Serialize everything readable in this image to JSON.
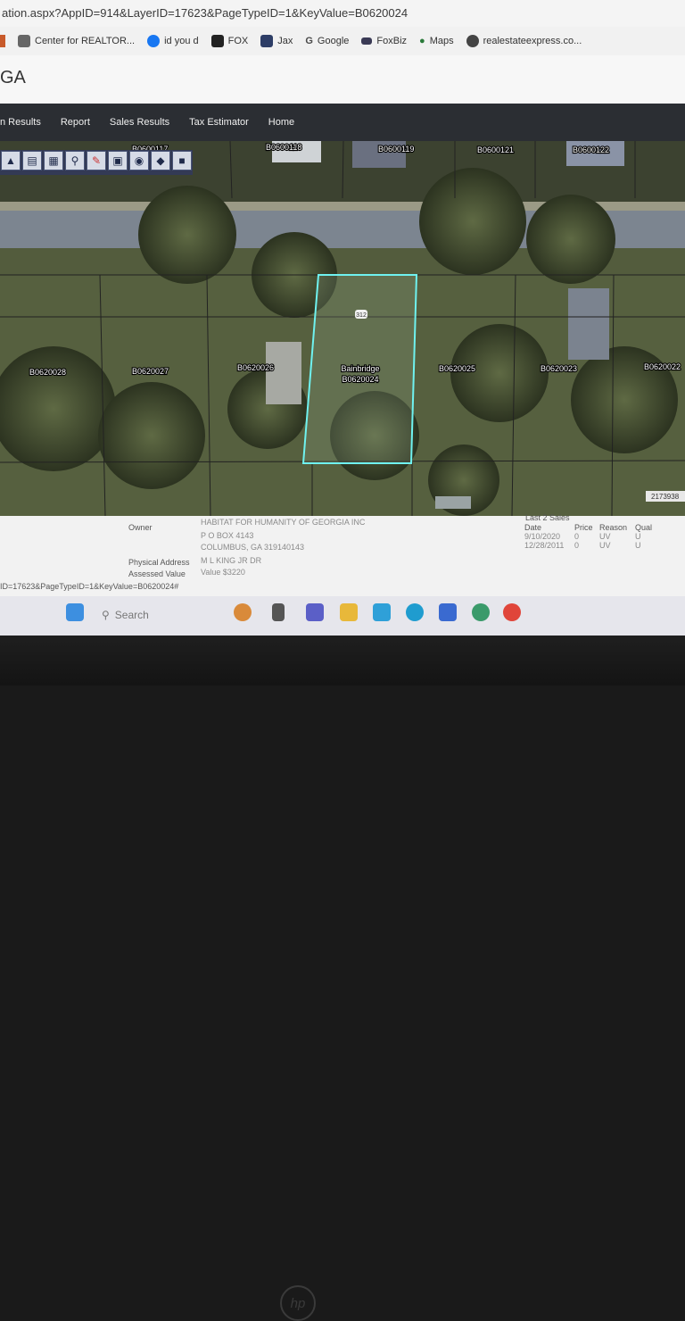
{
  "browser": {
    "url": "ation.aspx?AppID=914&LayerID=17623&PageTypeID=1&KeyValue=B0620024",
    "bookmarks": [
      {
        "label": "Center for REALTOR...",
        "icon": "bookmark-icon"
      },
      {
        "label": "id you d",
        "icon": "facebook-icon"
      },
      {
        "label": "FOX",
        "icon": "fox-icon"
      },
      {
        "label": "Jax",
        "icon": "page-icon"
      },
      {
        "label": "Google",
        "icon": "google-icon"
      },
      {
        "label": "FoxBiz",
        "icon": "foxbiz-icon"
      },
      {
        "label": "Maps",
        "icon": "maps-icon"
      },
      {
        "label": "realestateexpress.co...",
        "icon": "globe-icon"
      }
    ]
  },
  "app": {
    "title": "GA"
  },
  "nav": {
    "items": [
      "n Results",
      "Report",
      "Sales Results",
      "Tax Estimator",
      "Home"
    ]
  },
  "map": {
    "top_parcels": [
      "B0600117",
      "B0600118",
      "B0600119",
      "B0600121",
      "B0600122"
    ],
    "parcels": [
      "B0620028",
      "B0620027",
      "B0620026",
      "B0620025",
      "B0620023",
      "B0620022"
    ],
    "selected": {
      "name": "Bainbridge",
      "id": "B0620024",
      "number": "312"
    },
    "corner_id": "2173938"
  },
  "toolbar_icons": [
    "pan-icon",
    "layers-icon",
    "grid-icon",
    "zoom-icon",
    "pencil-icon",
    "extent-icon",
    "measure-icon",
    "select-icon",
    "save-icon"
  ],
  "parcel_info": {
    "owner_label": "Owner",
    "owner_lines": [
      "HABITAT FOR HUMANITY OF GEORGIA INC",
      "P O BOX 4143",
      "COLUMBUS, GA 319140143"
    ],
    "physical_address_label": "Physical Address",
    "physical_address": "M L KING JR DR",
    "assessed_value_label": "Assessed Value",
    "assessed_value": "Value $3220",
    "sales_title": "Last 2 Sales",
    "sales_headers": [
      "Date",
      "Price",
      "Reason",
      "Qual"
    ],
    "sales_rows": [
      [
        "9/10/2020",
        "0",
        "UV",
        "U"
      ],
      [
        "12/28/2011",
        "0",
        "UV",
        "U"
      ]
    ]
  },
  "status_url": "ID=17623&PageTypeID=1&KeyValue=B0620024#",
  "taskbar": {
    "search_placeholder": "Search"
  },
  "brand": "hp",
  "colors": {
    "nav_bg": "#2b2e33",
    "parcel_outline": "#6ff2f0",
    "taskbar_bg": "#e6e6ec"
  }
}
